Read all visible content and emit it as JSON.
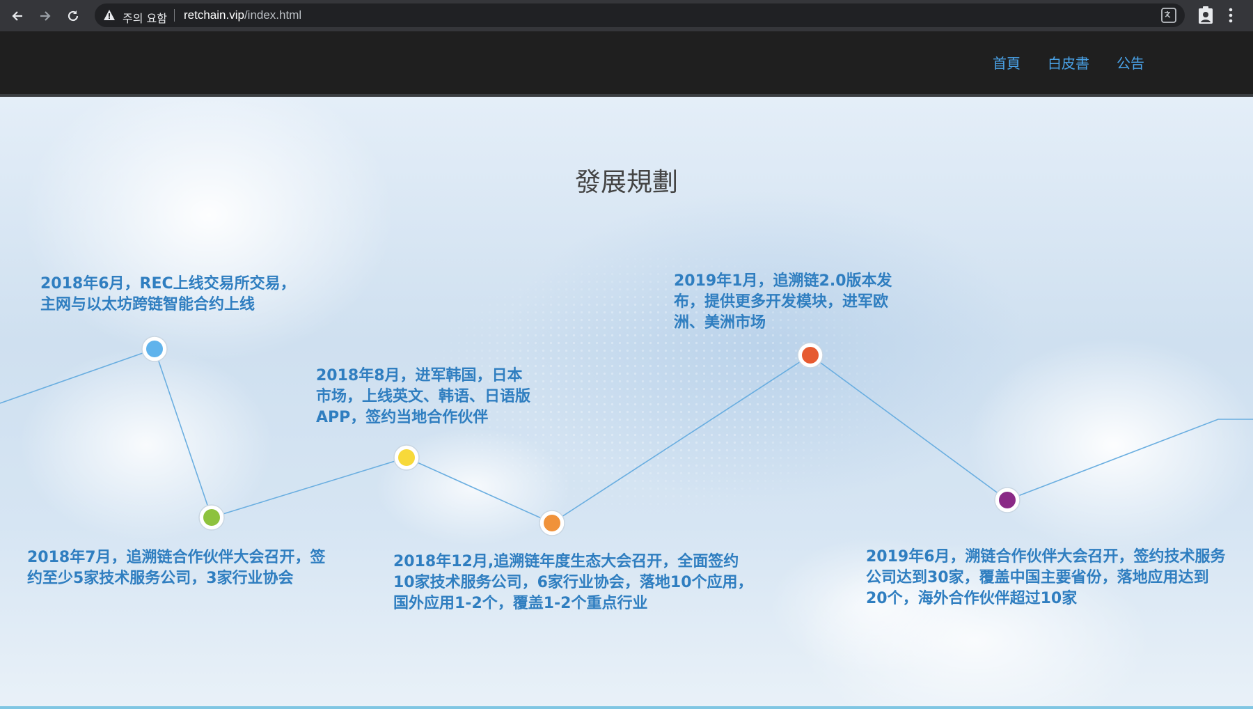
{
  "browser": {
    "security_label": "주의 요함",
    "url_host": "retchain.vip",
    "url_path": "/index.html"
  },
  "site_nav": {
    "items": [
      {
        "label": "首頁"
      },
      {
        "label": "白皮書"
      },
      {
        "label": "公告"
      }
    ]
  },
  "page": {
    "title": "發展規劃"
  },
  "timeline": {
    "line_color": "#6aaee0",
    "milestones": [
      {
        "text": "2018年6月，REC上线交易所交易，主网与以太坊跨链智能合约上线",
        "color": "#5fb3ec"
      },
      {
        "text": "2018年7月，追溯链合作伙伴大会召开，签约至少5家技术服务公司，3家行业协会",
        "color": "#8dc23d"
      },
      {
        "text": "2018年8月，进军韩国，日本市场，上线英文、韩语、日语版APP，签约当地合作伙伴",
        "color": "#f7d93a"
      },
      {
        "text": "2018年12月,追溯链年度生态大会召开，全面签约10家技术服务公司，6家行业协会，落地10个应用，国外应用1-2个，覆盖1-2个重点行业",
        "color": "#f0923a"
      },
      {
        "text": "2019年1月，追溯链2.0版本发布，提供更多开发模块，进军欧洲、美洲市场",
        "color": "#e65a30"
      },
      {
        "text": "2019年6月，溯链合作伙伴大会召开，签约技术服务公司达到30家，覆盖中国主要省份，落地应用达到20个，海外合作伙伴超过10家",
        "color": "#8a2a86"
      }
    ]
  }
}
